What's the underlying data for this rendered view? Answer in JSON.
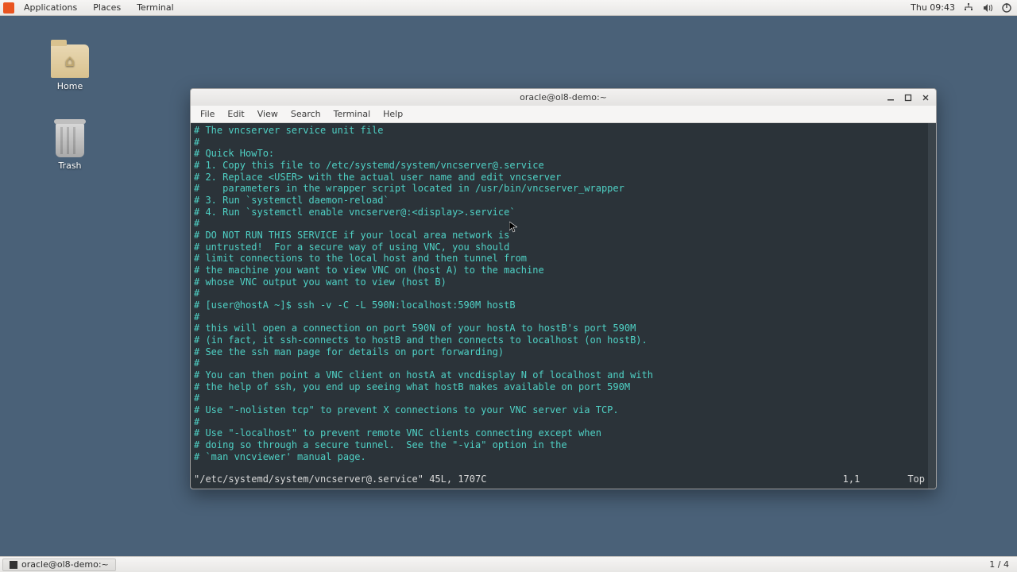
{
  "panel": {
    "menus": [
      "Applications",
      "Places",
      "Terminal"
    ],
    "clock": "Thu 09:43"
  },
  "desktop": {
    "home_label": "Home",
    "trash_label": "Trash"
  },
  "window": {
    "title": "oracle@ol8-demo:~",
    "menubar": [
      "File",
      "Edit",
      "View",
      "Search",
      "Terminal",
      "Help"
    ]
  },
  "terminal": {
    "lines": [
      "# The vncserver service unit file",
      "#",
      "# Quick HowTo:",
      "# 1. Copy this file to /etc/systemd/system/vncserver@.service",
      "# 2. Replace <USER> with the actual user name and edit vncserver",
      "#    parameters in the wrapper script located in /usr/bin/vncserver_wrapper",
      "# 3. Run `systemctl daemon-reload`",
      "# 4. Run `systemctl enable vncserver@:<display>.service`",
      "#",
      "# DO NOT RUN THIS SERVICE if your local area network is",
      "# untrusted!  For a secure way of using VNC, you should",
      "# limit connections to the local host and then tunnel from",
      "# the machine you want to view VNC on (host A) to the machine",
      "# whose VNC output you want to view (host B)",
      "#",
      "# [user@hostA ~]$ ssh -v -C -L 590N:localhost:590M hostB",
      "#",
      "# this will open a connection on port 590N of your hostA to hostB's port 590M",
      "# (in fact, it ssh-connects to hostB and then connects to localhost (on hostB).",
      "# See the ssh man page for details on port forwarding)",
      "#",
      "# You can then point a VNC client on hostA at vncdisplay N of localhost and with",
      "# the help of ssh, you end up seeing what hostB makes available on port 590M",
      "#",
      "# Use \"-nolisten tcp\" to prevent X connections to your VNC server via TCP.",
      "#",
      "# Use \"-localhost\" to prevent remote VNC clients connecting except when",
      "# doing so through a secure tunnel.  See the \"-via\" option in the",
      "# `man vncviewer' manual page."
    ],
    "status_file": "\"/etc/systemd/system/vncserver@.service\" 45L, 1707C",
    "status_pos": "1,1",
    "status_pct": "Top"
  },
  "taskbar": {
    "task_label": "oracle@ol8-demo:~",
    "workspace": "1 / 4"
  }
}
